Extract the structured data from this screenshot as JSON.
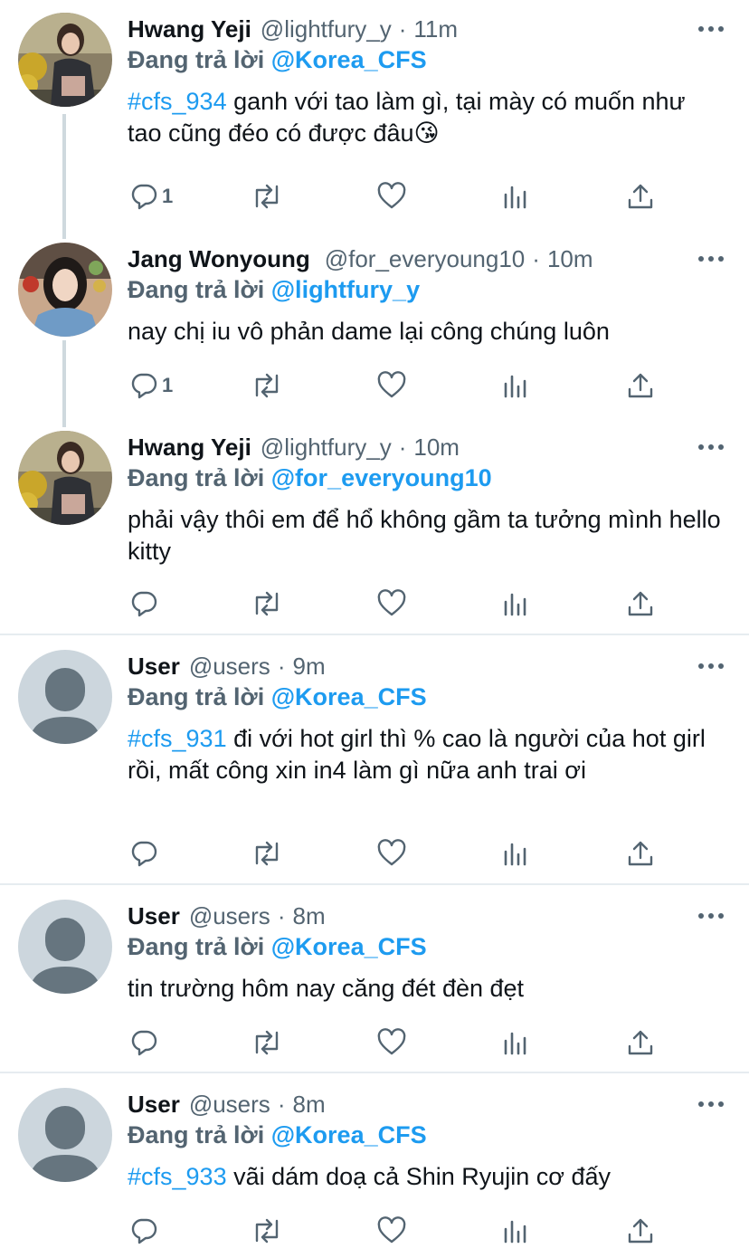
{
  "tweets": [
    {
      "name": "Hwang Yeji",
      "handle": "@lightfury_y",
      "time": "11m",
      "reply_prefix": "Đang trả lời",
      "reply_to": "@Korea_CFS",
      "hashtag": "#cfs_934",
      "text": " ganh với tao làm gì, tại mày có muốn như tao cũng đéo có được đâu😘",
      "reply_count": "1",
      "avatar": "photo-avatar-hwang-yeji"
    },
    {
      "name": "Jang Wonyoung",
      "handle": "@for_everyoung10",
      "time": "10m",
      "reply_prefix": "Đang trả lời",
      "reply_to": "@lightfury_y",
      "hashtag": "",
      "text": "nay chị iu vô phản dame lại công chúng luôn",
      "reply_count": "1",
      "avatar": "photo-avatar-jang-wonyoung"
    },
    {
      "name": "Hwang Yeji",
      "handle": "@lightfury_y",
      "time": "10m",
      "reply_prefix": "Đang trả lời",
      "reply_to": "@for_everyoung10",
      "hashtag": "",
      "text": "phải vậy thôi em để hổ không gầm ta tưởng mình hello kitty",
      "reply_count": "",
      "avatar": "photo-avatar-hwang-yeji"
    },
    {
      "name": "User",
      "handle": "@users",
      "time": "9m",
      "reply_prefix": "Đang trả lời",
      "reply_to": "@Korea_CFS",
      "hashtag": "#cfs_931",
      "text": " đi với hot girl thì % cao là người của hot girl rồi, mất công xin in4 làm gì nữa anh trai ơi",
      "reply_count": "",
      "avatar": "default-avatar-icon"
    },
    {
      "name": "User",
      "handle": "@users",
      "time": "8m",
      "reply_prefix": "Đang trả lời",
      "reply_to": "@Korea_CFS",
      "hashtag": "",
      "text": "tin trường hôm nay căng đét đèn đẹt",
      "reply_count": "",
      "avatar": "default-avatar-icon"
    },
    {
      "name": "User",
      "handle": "@users",
      "time": "8m",
      "reply_prefix": "Đang trả lời",
      "reply_to": "@Korea_CFS",
      "hashtag": "#cfs_933",
      "text": " vãi dám doạ cả Shin Ryujin cơ đấy",
      "reply_count": "",
      "avatar": "default-avatar-icon"
    }
  ],
  "separator_dot": "·",
  "colors": {
    "accent": "#1d9bf0",
    "secondary_text": "#536471",
    "primary_text": "#0f1419",
    "divider": "#e6ecf0",
    "thread_line": "#cfd9de",
    "default_avatar_bg": "#ccd6dd",
    "default_avatar_fg": "#66757f"
  },
  "action_icons": [
    "reply-icon",
    "retweet-icon",
    "like-icon",
    "analytics-icon",
    "share-icon"
  ]
}
